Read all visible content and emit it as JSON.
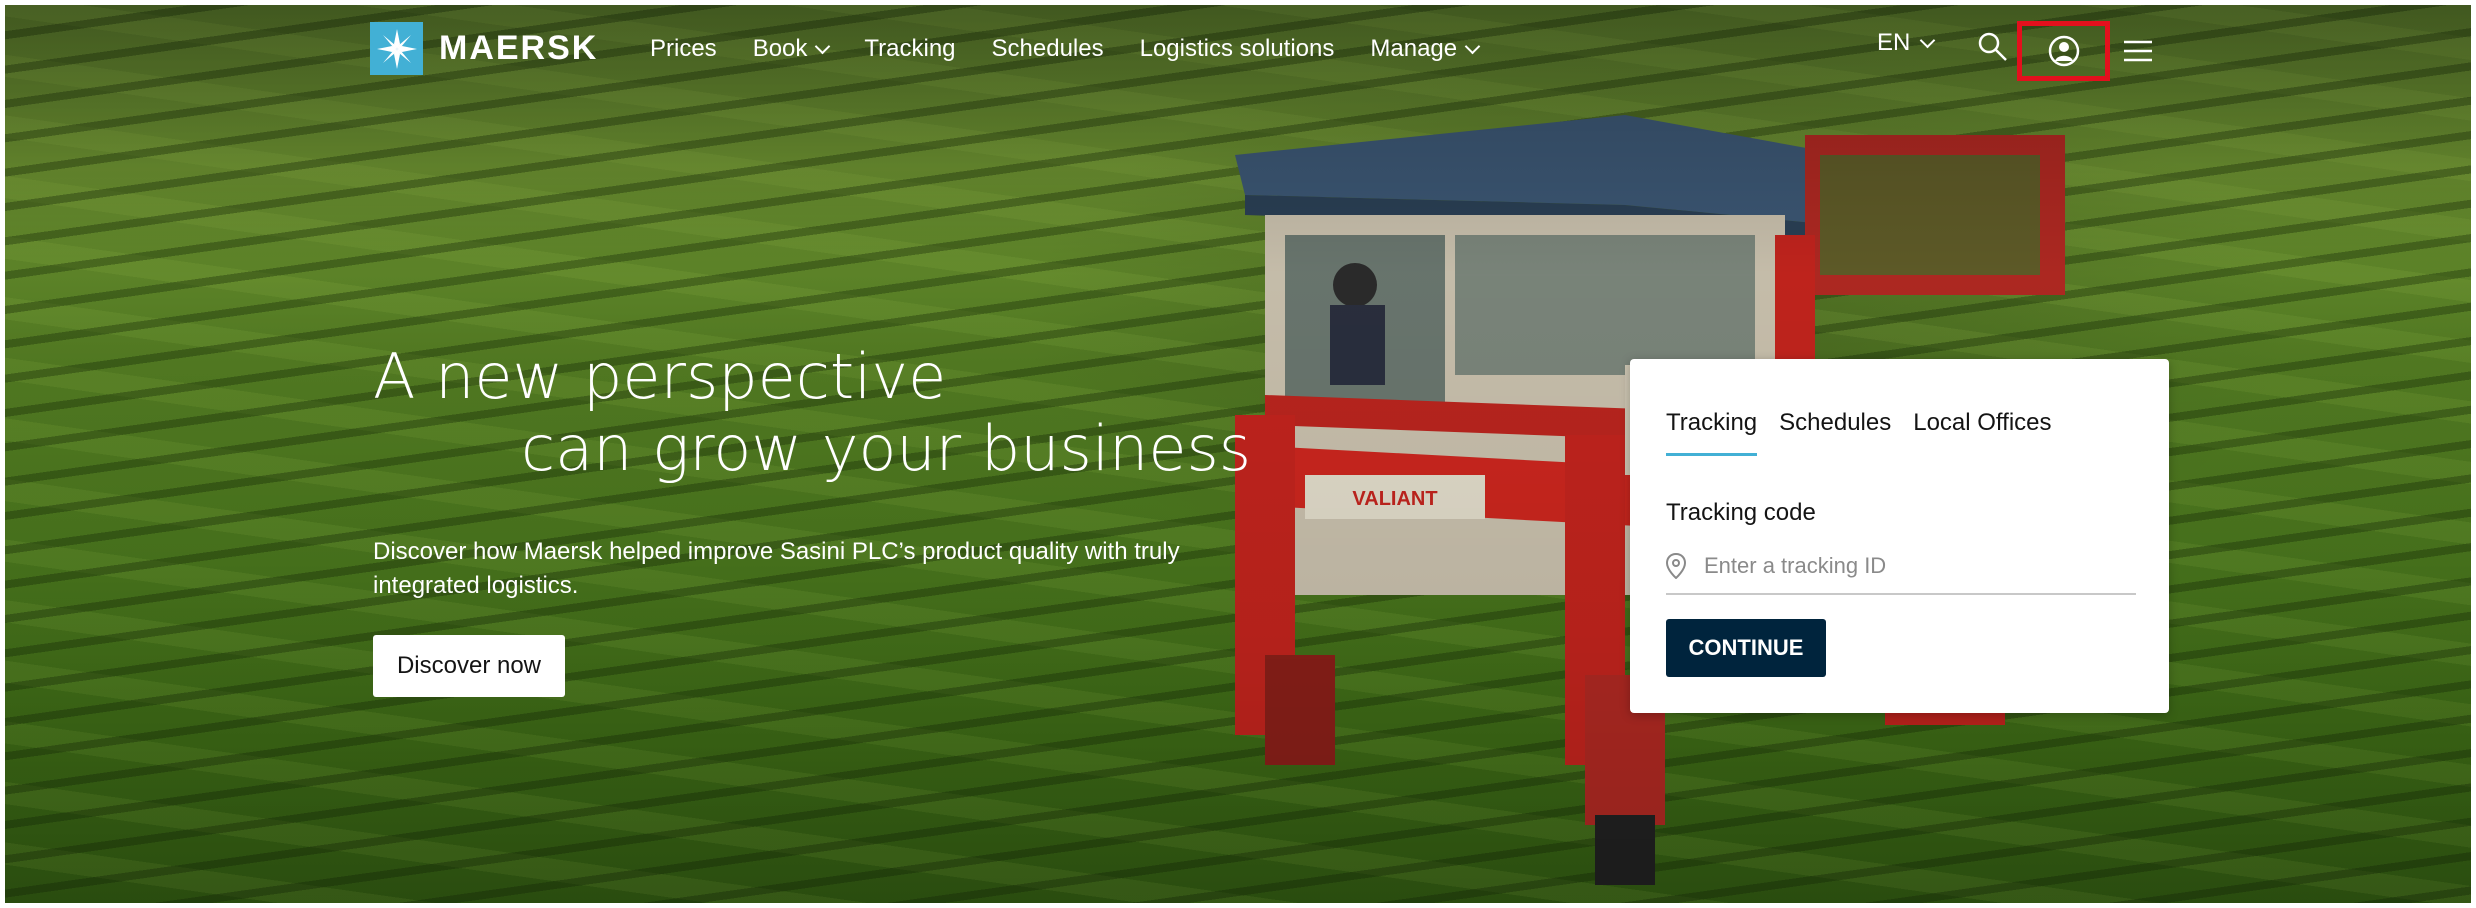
{
  "brand": {
    "name": "MAERSK",
    "accent_color": "#42b0d5",
    "logo_icon": "star-icon"
  },
  "nav": {
    "items": [
      {
        "label": "Prices",
        "has_dropdown": false
      },
      {
        "label": "Book",
        "has_dropdown": true
      },
      {
        "label": "Tracking",
        "has_dropdown": false
      },
      {
        "label": "Schedules",
        "has_dropdown": false
      },
      {
        "label": "Logistics solutions",
        "has_dropdown": false
      },
      {
        "label": "Manage",
        "has_dropdown": true
      }
    ]
  },
  "header_tools": {
    "language": "EN",
    "search_icon": "search-icon",
    "profile_icon": "user-profile-icon",
    "menu_icon": "hamburger-menu-icon",
    "highlight_color": "#e3101d"
  },
  "hero": {
    "headline_line1": "A new perspective",
    "headline_line2": "can grow your business",
    "description": "Discover how Maersk helped improve Sasini PLC’s product quality with truly integrated logistics.",
    "cta_label": "Discover now"
  },
  "tracking_card": {
    "tabs": [
      "Tracking",
      "Schedules",
      "Local Offices"
    ],
    "active_tab": "Tracking",
    "field_label": "Tracking code",
    "placeholder": "Enter a tracking ID",
    "value": "",
    "button_label": "CONTINUE",
    "button_color": "#00243d"
  }
}
